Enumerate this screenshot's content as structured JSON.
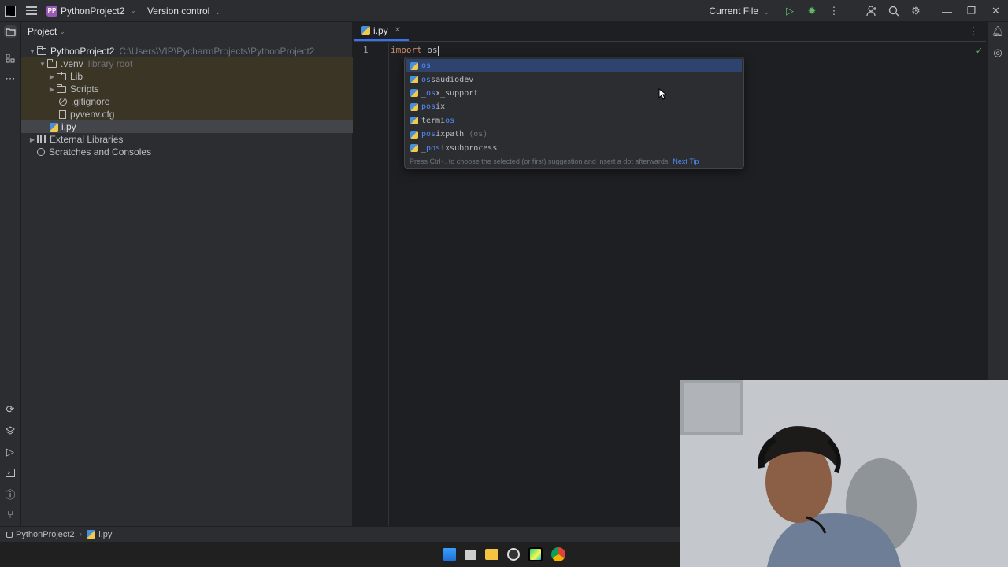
{
  "titlebar": {
    "project_badge": "PP",
    "project_name": "PythonProject2",
    "version_control": "Version control",
    "run_config": "Current File"
  },
  "project_panel": {
    "title": "Project",
    "tree": [
      {
        "label": "PythonProject2",
        "hint": "C:\\Users\\VIP\\PycharmProjects\\PythonProject2"
      },
      {
        "label": ".venv",
        "hint": "library root"
      },
      {
        "label": "Lib"
      },
      {
        "label": "Scripts"
      },
      {
        "label": ".gitignore"
      },
      {
        "label": "pyvenv.cfg"
      },
      {
        "label": "i.py"
      },
      {
        "label": "External Libraries"
      },
      {
        "label": "Scratches and Consoles"
      }
    ]
  },
  "editor": {
    "tab_label": "i.py",
    "line_number": "1",
    "code_keyword": "import",
    "code_rest": "os"
  },
  "completion": {
    "items": [
      {
        "match": "os",
        "rest": "",
        "hint": ""
      },
      {
        "match": "os",
        "rest": "saudiodev",
        "hint": ""
      },
      {
        "pre": "_",
        "match": "os",
        "rest": "x_support",
        "hint": ""
      },
      {
        "match": "pos",
        "rest": "ix",
        "hint": ""
      },
      {
        "pre": "termi",
        "match": "os",
        "rest": "",
        "hint": ""
      },
      {
        "match": "pos",
        "rest": "ixpath",
        "hint": "(os)"
      },
      {
        "pre": "_",
        "match": "pos",
        "rest": "ixsubprocess",
        "hint": ""
      }
    ],
    "footer": "Press Ctrl+. to choose the selected (or first) suggestion and insert a dot afterwards",
    "next_tip": "Next Tip"
  },
  "statusbar": {
    "project": "PythonProject2",
    "file": "i.py"
  },
  "colors": {
    "accent": "#3574f0",
    "venv_highlight": "#3b3526",
    "popup_selected": "#2e436e"
  }
}
